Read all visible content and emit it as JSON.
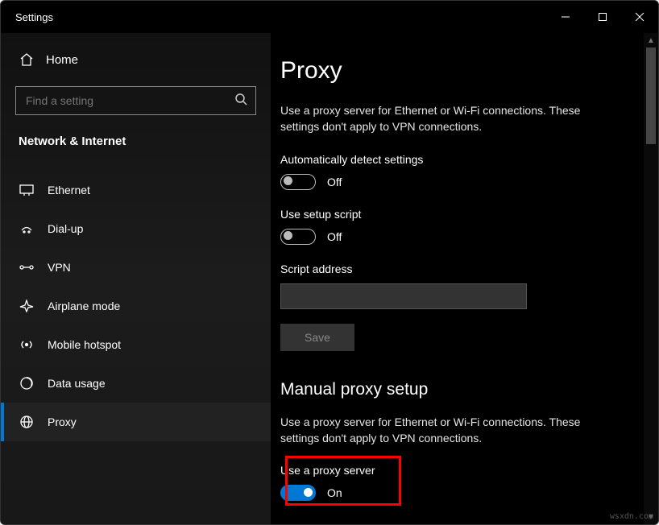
{
  "window": {
    "title": "Settings"
  },
  "sidebar": {
    "home": "Home",
    "search_placeholder": "Find a setting",
    "section": "Network & Internet",
    "items": [
      {
        "label": "Ethernet"
      },
      {
        "label": "Dial-up"
      },
      {
        "label": "VPN"
      },
      {
        "label": "Airplane mode"
      },
      {
        "label": "Mobile hotspot"
      },
      {
        "label": "Data usage"
      },
      {
        "label": "Proxy"
      }
    ]
  },
  "page": {
    "title": "Proxy",
    "auto": {
      "desc": "Use a proxy server for Ethernet or Wi-Fi connections. These settings don't apply to VPN connections.",
      "detect_label": "Automatically detect settings",
      "detect_state": "Off",
      "script_label": "Use setup script",
      "script_state": "Off",
      "address_label": "Script address",
      "address_value": "",
      "save": "Save"
    },
    "manual": {
      "heading": "Manual proxy setup",
      "desc": "Use a proxy server for Ethernet or Wi-Fi connections. These settings don't apply to VPN connections.",
      "use_label": "Use a proxy server",
      "use_state": "On"
    }
  },
  "watermark": "wsxdn.com"
}
